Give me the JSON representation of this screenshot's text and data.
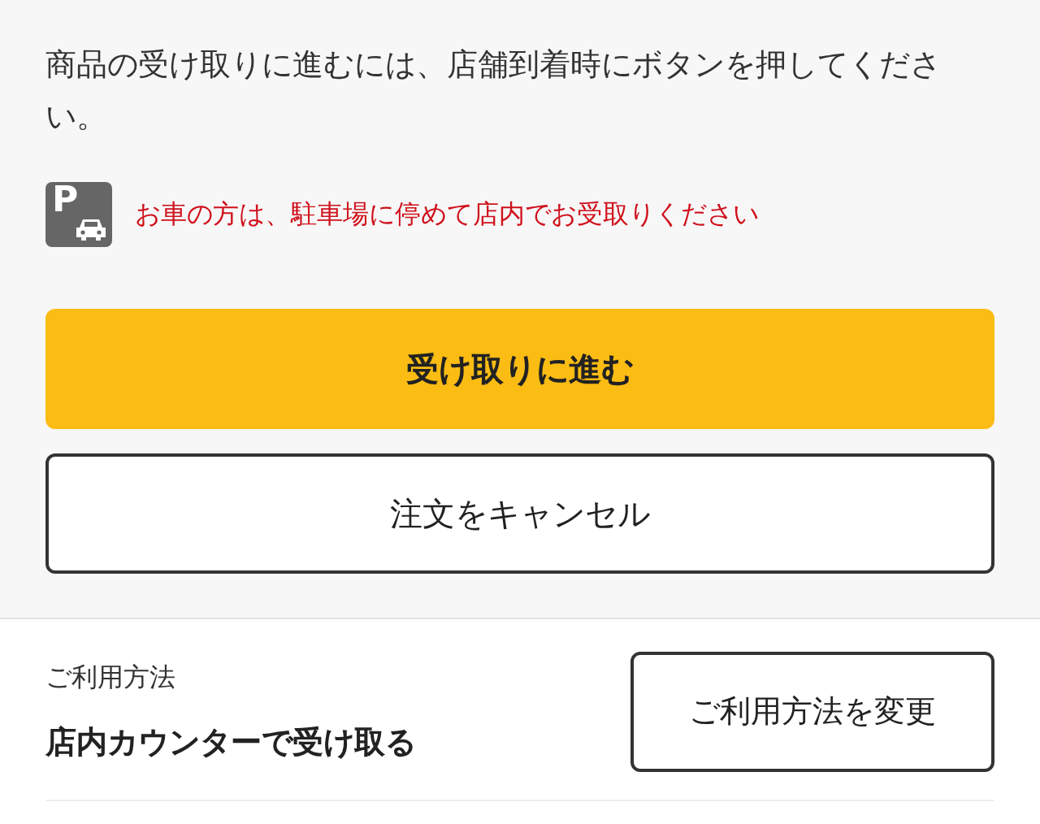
{
  "instruction": "商品の受け取りに進むには、店舗到着時にボタンを押してください。",
  "parking_notice": {
    "icon_letter": "P",
    "text": "お車の方は、駐車場に停めて店内でお受取りください"
  },
  "buttons": [
    {
      "label": "受け取りに進む",
      "kind": "primary"
    },
    {
      "label": "注文をキャンセル",
      "kind": "outline"
    }
  ],
  "usage": {
    "label": "ご利用方法",
    "value": "店内カウンターで受け取る",
    "button": "ご利用方法を変更"
  }
}
